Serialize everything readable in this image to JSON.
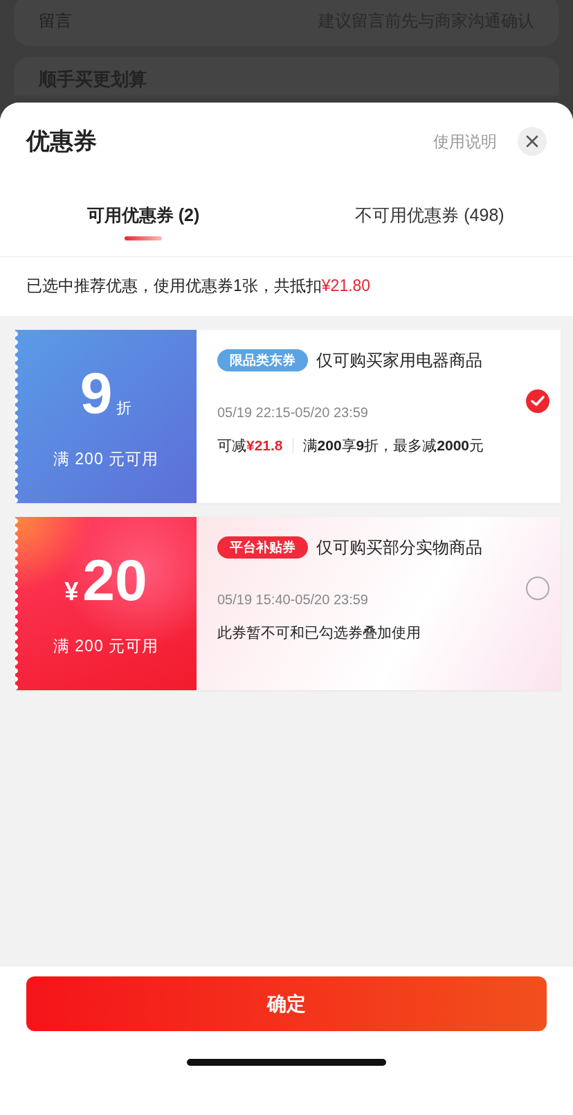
{
  "background_page": {
    "remark_label": "留言",
    "remark_placeholder": "建议留言前先与商家沟通确认",
    "section_title": "顺手买更划算"
  },
  "sheet": {
    "title": "优惠券",
    "help_link": "使用说明"
  },
  "tabs": [
    {
      "label": "可用优惠券 (2)",
      "selected": true
    },
    {
      "label": "不可用优惠券 (498)",
      "selected": false
    }
  ],
  "summary": {
    "text": "已选中推荐优惠，使用优惠券1张，共抵扣",
    "amount": "¥21.80"
  },
  "coupons": [
    {
      "kind": "discount",
      "value": "9",
      "unit": "折",
      "condition": "满 200 元可用",
      "tag": "限品类东券",
      "color": "#5ba3e3",
      "scope": "仅可购买家用电器商品",
      "validity": "05/19 22:15-05/20 23:59",
      "saving_label": "可减",
      "saving_amount": "¥21.8",
      "rule": "满**200**享**9**折，最多减**2000**元",
      "selected": true
    },
    {
      "kind": "cash",
      "value": "20",
      "unit": "¥",
      "condition": "满 200 元可用",
      "tag": "平台补贴券",
      "color": "#f02a3a",
      "scope": "仅可购买部分实物商品",
      "validity": "05/19 15:40-05/20 23:59",
      "note": "此券暂不可和已勾选券叠加使用",
      "selected": false
    }
  ],
  "confirm_button": "确定"
}
